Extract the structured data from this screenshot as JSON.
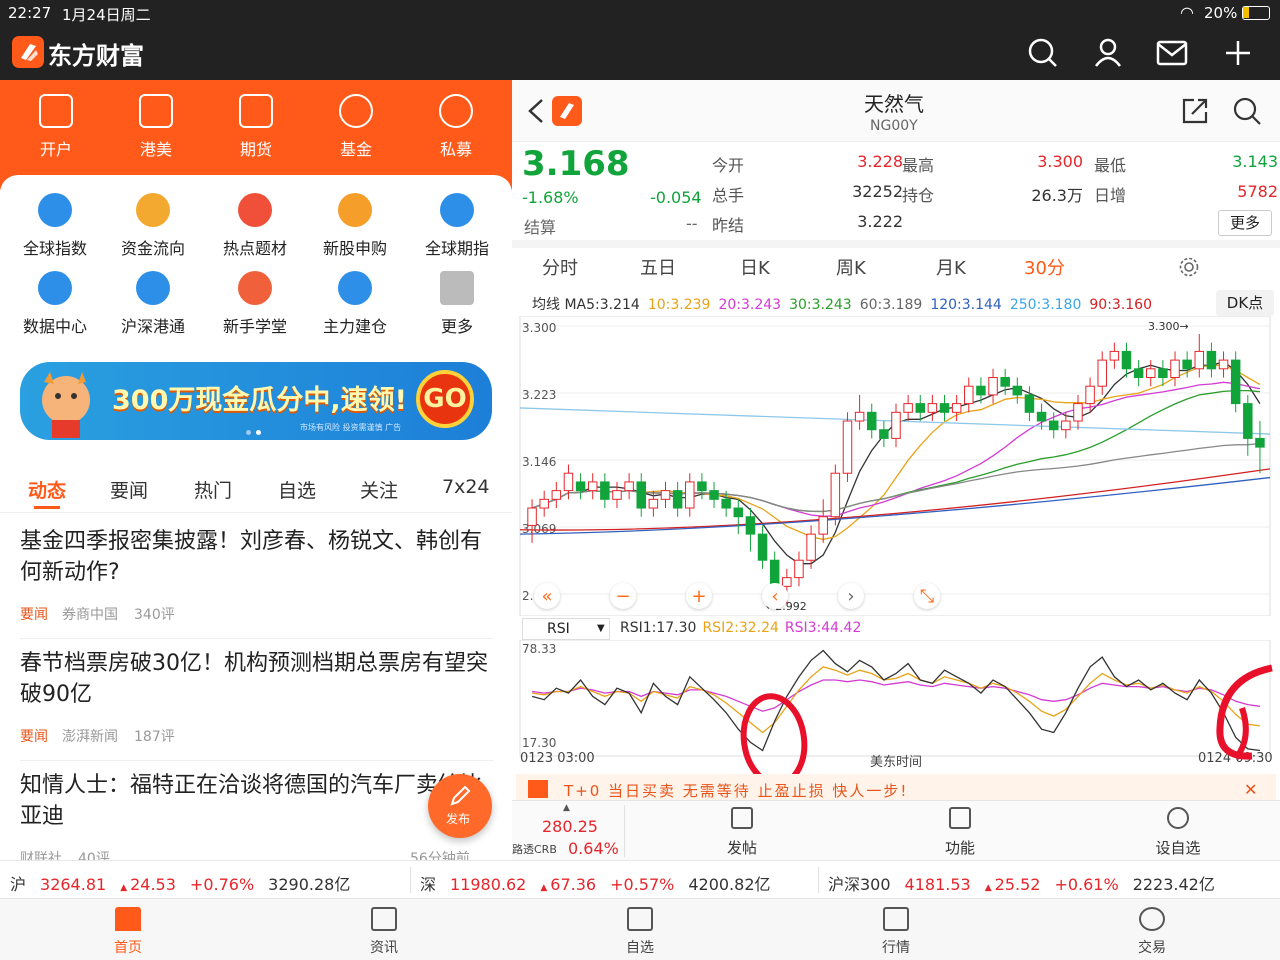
{
  "status_bar": {
    "time": "22:27",
    "date": "1月24日周二",
    "battery": "20%"
  },
  "app": {
    "name": "东方财富",
    "brand_color": "#ff5a1a"
  },
  "left": {
    "top_menu": [
      {
        "label": "开户",
        "icon": "ipo-icon"
      },
      {
        "label": "港美",
        "icon": "hk-icon"
      },
      {
        "label": "期货",
        "icon": "futures-icon"
      },
      {
        "label": "基金",
        "icon": "fund-icon"
      },
      {
        "label": "私募",
        "icon": "diamond-icon"
      }
    ],
    "grid": [
      {
        "label": "全球指数",
        "icon": "planet-icon"
      },
      {
        "label": "资金流向",
        "icon": "coin-icon"
      },
      {
        "label": "热点题材",
        "icon": "fire-icon"
      },
      {
        "label": "新股申购",
        "icon": "ipo-badge-icon"
      },
      {
        "label": "全球期指",
        "icon": "globe-icon"
      },
      {
        "label": "数据中心",
        "icon": "pie-icon"
      },
      {
        "label": "沪深港通",
        "icon": "flower-icon"
      },
      {
        "label": "新手学堂",
        "icon": "book-icon"
      },
      {
        "label": "主力建仓",
        "icon": "house-icon"
      },
      {
        "label": "更多",
        "icon": "grid-icon"
      }
    ],
    "banner": {
      "text": "300万现金瓜分中,速领!",
      "go": "GO",
      "disclaimer": "市场有风险 投资需谨慎 广告"
    },
    "news_tabs": [
      "动态",
      "要闻",
      "热门",
      "自选",
      "关注",
      "7x24"
    ],
    "news": [
      {
        "title": "基金四季报密集披露！刘彦春、杨锐文、韩创有何新动作?",
        "tag": "要闻",
        "source": "券商中国",
        "comments": "340评"
      },
      {
        "title": "春节档票房破30亿！机构预测档期总票房有望突破90亿",
        "tag": "要闻",
        "source": "澎湃新闻",
        "comments": "187评"
      },
      {
        "title": "知情人士：福特正在洽谈将德国的汽车厂卖给比亚迪",
        "tag": "",
        "source": "财联社",
        "comments": "40评",
        "time": "56分钟前"
      }
    ],
    "publish_label": "发布"
  },
  "right": {
    "title": "天然气",
    "code": "NG00Y",
    "price": "3.168",
    "change_pct": "-1.68%",
    "change": "-0.054",
    "settle_label": "结算",
    "settle_value": "--",
    "stats": [
      {
        "label": "今开",
        "value": "3.228",
        "color": "red"
      },
      {
        "label": "最高",
        "value": "3.300",
        "color": "red"
      },
      {
        "label": "最低",
        "value": "3.143",
        "color": "green"
      },
      {
        "label": "总手",
        "value": "32252",
        "color": "dark"
      },
      {
        "label": "持仓",
        "value": "26.3万",
        "color": "dark"
      },
      {
        "label": "日增",
        "value": "5782",
        "color": "red"
      },
      {
        "label": "昨结",
        "value": "3.222",
        "color": "dark"
      }
    ],
    "more_label": "更多",
    "period_tabs": [
      "分时",
      "五日",
      "日K",
      "周K",
      "月K",
      "30分"
    ],
    "ma_line": [
      {
        "text": "均线 MA5:3.214",
        "color": "#333"
      },
      {
        "text": "10:3.239",
        "color": "#e8a317"
      },
      {
        "text": "20:3.243",
        "color": "#d43ad4"
      },
      {
        "text": "30:3.243",
        "color": "#2a9d2a"
      },
      {
        "text": "60:3.189",
        "color": "#666"
      },
      {
        "text": "120:3.144",
        "color": "#3060c0"
      },
      {
        "text": "250:3.180",
        "color": "#3aa6e8"
      },
      {
        "text": "90:3.160",
        "color": "#d42020"
      }
    ],
    "dk_label": "DK点",
    "y_labels": [
      "3.300",
      "3.223",
      "3.146",
      "3.069",
      "2.992"
    ],
    "high_mark": "3.300",
    "low_mark": "2.992",
    "rsi_select": "RSI",
    "rsi_values": [
      {
        "text": "RSI1:17.30",
        "color": "#333"
      },
      {
        "text": "RSI2:32.24",
        "color": "#e8a317"
      },
      {
        "text": "RSI3:44.42",
        "color": "#d43ad4"
      }
    ],
    "rsi_top": "78.33",
    "rsi_bottom": "17.30",
    "time_left": "0123 03:00",
    "time_mid": "美东时间",
    "time_right": "0124 09:30",
    "promo": "T+0 当日买卖 无需等待 止盈止损 快人一步!",
    "crb_value": "280.25",
    "crb_label": "路透CRB",
    "crb_pct": "0.64%",
    "actions": [
      {
        "label": "发帖",
        "icon": "edit-icon"
      },
      {
        "label": "功能",
        "icon": "apps-icon"
      },
      {
        "label": "设自选",
        "icon": "more-icon"
      }
    ]
  },
  "ticker": [
    {
      "name": "沪",
      "price": "3264.81",
      "change": "24.53",
      "pct": "+0.76%",
      "amount": "3290.28亿"
    },
    {
      "name": "深",
      "price": "11980.62",
      "change": "67.36",
      "pct": "+0.57%",
      "amount": "4200.82亿"
    },
    {
      "name": "沪深300",
      "price": "4181.53",
      "change": "25.52",
      "pct": "+0.61%",
      "amount": "2223.42亿"
    }
  ],
  "bottom_nav": [
    {
      "label": "首页",
      "icon": "home-icon"
    },
    {
      "label": "资讯",
      "icon": "news-icon"
    },
    {
      "label": "自选",
      "icon": "watchlist-icon"
    },
    {
      "label": "行情",
      "icon": "market-icon"
    },
    {
      "label": "交易",
      "icon": "trade-icon"
    }
  ],
  "chart_data": {
    "type": "candlestick",
    "ylim": [
      2.992,
      3.3
    ],
    "candles": [
      [
        3.08,
        3.1,
        3.06,
        3.11
      ],
      [
        3.1,
        3.11,
        3.09,
        3.12
      ],
      [
        3.11,
        3.12,
        3.1,
        3.13
      ],
      [
        3.12,
        3.14,
        3.11,
        3.15
      ],
      [
        3.13,
        3.12,
        3.11,
        3.14
      ],
      [
        3.12,
        3.13,
        3.11,
        3.14
      ],
      [
        3.13,
        3.11,
        3.1,
        3.14
      ],
      [
        3.11,
        3.12,
        3.1,
        3.13
      ],
      [
        3.12,
        3.13,
        3.11,
        3.14
      ],
      [
        3.13,
        3.1,
        3.09,
        3.14
      ],
      [
        3.1,
        3.11,
        3.09,
        3.12
      ],
      [
        3.11,
        3.12,
        3.1,
        3.13
      ],
      [
        3.12,
        3.1,
        3.09,
        3.13
      ],
      [
        3.1,
        3.13,
        3.09,
        3.14
      ],
      [
        3.13,
        3.12,
        3.11,
        3.14
      ],
      [
        3.12,
        3.11,
        3.1,
        3.13
      ],
      [
        3.11,
        3.1,
        3.09,
        3.12
      ],
      [
        3.1,
        3.09,
        3.07,
        3.11
      ],
      [
        3.09,
        3.07,
        3.05,
        3.1
      ],
      [
        3.07,
        3.04,
        3.03,
        3.08
      ],
      [
        3.04,
        3.01,
        2.99,
        3.05
      ],
      [
        3.01,
        3.02,
        2.99,
        3.03
      ],
      [
        3.02,
        3.04,
        3.01,
        3.05
      ],
      [
        3.04,
        3.07,
        3.03,
        3.08
      ],
      [
        3.07,
        3.09,
        3.06,
        3.11
      ],
      [
        3.09,
        3.14,
        3.08,
        3.15
      ],
      [
        3.14,
        3.2,
        3.13,
        3.21
      ],
      [
        3.2,
        3.21,
        3.19,
        3.23
      ],
      [
        3.21,
        3.19,
        3.18,
        3.22
      ],
      [
        3.19,
        3.18,
        3.17,
        3.2
      ],
      [
        3.18,
        3.21,
        3.17,
        3.22
      ],
      [
        3.21,
        3.22,
        3.2,
        3.23
      ],
      [
        3.22,
        3.21,
        3.2,
        3.23
      ],
      [
        3.21,
        3.22,
        3.2,
        3.23
      ],
      [
        3.22,
        3.21,
        3.2,
        3.23
      ],
      [
        3.21,
        3.22,
        3.2,
        3.23
      ],
      [
        3.22,
        3.24,
        3.21,
        3.25
      ],
      [
        3.24,
        3.23,
        3.22,
        3.25
      ],
      [
        3.23,
        3.25,
        3.22,
        3.26
      ],
      [
        3.25,
        3.24,
        3.23,
        3.26
      ],
      [
        3.24,
        3.23,
        3.22,
        3.25
      ],
      [
        3.23,
        3.21,
        3.2,
        3.24
      ],
      [
        3.21,
        3.2,
        3.19,
        3.22
      ],
      [
        3.2,
        3.19,
        3.18,
        3.21
      ],
      [
        3.19,
        3.2,
        3.18,
        3.21
      ],
      [
        3.2,
        3.22,
        3.19,
        3.23
      ],
      [
        3.22,
        3.24,
        3.21,
        3.25
      ],
      [
        3.24,
        3.27,
        3.23,
        3.28
      ],
      [
        3.27,
        3.28,
        3.26,
        3.29
      ],
      [
        3.28,
        3.26,
        3.25,
        3.29
      ],
      [
        3.26,
        3.25,
        3.24,
        3.27
      ],
      [
        3.25,
        3.26,
        3.24,
        3.27
      ],
      [
        3.26,
        3.25,
        3.24,
        3.27
      ],
      [
        3.25,
        3.27,
        3.24,
        3.28
      ],
      [
        3.27,
        3.26,
        3.25,
        3.28
      ],
      [
        3.26,
        3.28,
        3.25,
        3.3
      ],
      [
        3.28,
        3.26,
        3.25,
        3.29
      ],
      [
        3.26,
        3.27,
        3.25,
        3.28
      ],
      [
        3.27,
        3.22,
        3.21,
        3.28
      ],
      [
        3.22,
        3.18,
        3.16,
        3.23
      ],
      [
        3.18,
        3.17,
        3.14,
        3.2
      ]
    ],
    "rsi1": [
      50,
      48,
      55,
      52,
      60,
      50,
      45,
      55,
      52,
      40,
      58,
      50,
      45,
      62,
      55,
      48,
      40,
      30,
      22,
      17,
      35,
      50,
      62,
      72,
      78,
      70,
      65,
      72,
      68,
      60,
      64,
      70,
      60,
      58,
      66,
      62,
      58,
      52,
      60,
      56,
      48,
      40,
      30,
      28,
      40,
      55,
      68,
      74,
      62,
      56,
      60,
      54,
      58,
      52,
      48,
      60,
      52,
      40,
      25,
      18,
      17
    ],
    "rsi2": [
      52,
      51,
      53,
      53,
      56,
      53,
      50,
      53,
      52,
      47,
      53,
      51,
      49,
      56,
      54,
      51,
      46,
      40,
      34,
      28,
      34,
      44,
      54,
      62,
      68,
      66,
      63,
      66,
      64,
      60,
      61,
      64,
      60,
      58,
      62,
      60,
      58,
      55,
      58,
      56,
      52,
      47,
      41,
      38,
      42,
      50,
      58,
      64,
      60,
      57,
      58,
      55,
      57,
      54,
      52,
      56,
      53,
      47,
      39,
      33,
      32
    ],
    "rsi3": [
      53,
      52,
      53,
      53,
      55,
      54,
      52,
      53,
      53,
      50,
      53,
      52,
      51,
      54,
      54,
      52,
      50,
      47,
      44,
      41,
      43,
      48,
      53,
      57,
      60,
      60,
      59,
      60,
      59,
      57,
      58,
      59,
      57,
      56,
      58,
      57,
      56,
      55,
      56,
      55,
      53,
      51,
      48,
      47,
      48,
      51,
      55,
      58,
      57,
      56,
      56,
      55,
      56,
      54,
      53,
      55,
      54,
      51,
      47,
      45,
      44
    ]
  }
}
